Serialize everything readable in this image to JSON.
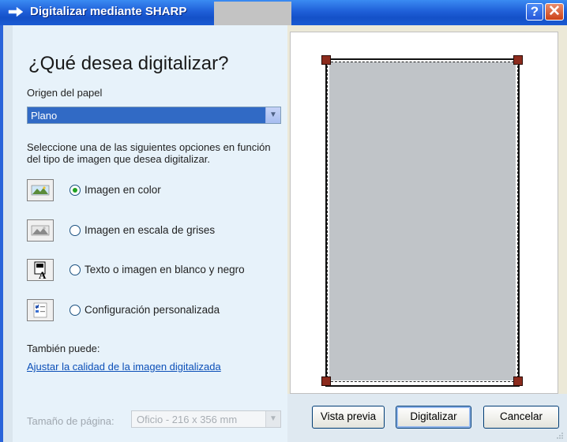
{
  "window": {
    "title": "Digitalizar mediante SHARP",
    "help_label": "?",
    "close_label": "✕",
    "icon": "scanner-arrow-icon"
  },
  "main": {
    "heading": "¿Qué desea digitalizar?",
    "origin_label": "Origen del papel",
    "origin_value": "Plano",
    "description": "Seleccione una de las siguientes opciones en función del tipo de imagen que desea digitalizar.",
    "options": [
      {
        "label": "Imagen en color",
        "selected": true,
        "icon": "color-picture-icon"
      },
      {
        "label": "Imagen en escala de grises",
        "selected": false,
        "icon": "grayscale-picture-icon"
      },
      {
        "label": "Texto o imagen en blanco y negro",
        "selected": false,
        "icon": "black-white-text-icon"
      },
      {
        "label": "Configuración personalizada",
        "selected": false,
        "icon": "custom-settings-icon"
      }
    ],
    "also_label": "También puede:",
    "quality_link": "Ajustar la calidad de la imagen digitalizada"
  },
  "footer": {
    "page_size_label": "Tamaño de página:",
    "page_size_value": "Oficio - 216 x 356 mm",
    "preview_button": "Vista previa",
    "scan_button": "Digitalizar",
    "cancel_button": "Cancelar"
  },
  "colors": {
    "title_bar": "#1f5fd8",
    "selection": "#316ac5",
    "link": "#0b4fb8",
    "handle": "#8c2b1d"
  }
}
